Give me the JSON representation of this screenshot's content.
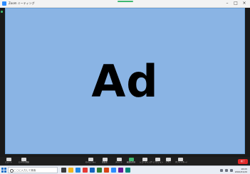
{
  "window": {
    "title": "Zoom ミーティング",
    "controls": [
      "–",
      "□",
      "×"
    ]
  },
  "slide": {
    "text": "Ad",
    "background": "#8ab4e4"
  },
  "meeting_bar": {
    "items": [
      {
        "label": "ミュート",
        "icon": "microphone-icon"
      },
      {
        "label": "ビデオの開始",
        "icon": "video-icon"
      },
      {
        "label": "セキュリティ",
        "icon": "shield-icon"
      },
      {
        "label": "参加者",
        "icon": "participants-icon"
      },
      {
        "label": "チャット",
        "icon": "chat-icon"
      },
      {
        "label": "画面を共有",
        "icon": "share-screen-icon"
      },
      {
        "label": "レコーディング",
        "icon": "record-icon"
      },
      {
        "label": "リアクション",
        "icon": "reaction-icon"
      },
      {
        "label": "アプリ",
        "icon": "apps-icon"
      },
      {
        "label": "ホワイトボード",
        "icon": "whiteboard-icon"
      }
    ],
    "end_label": "終了"
  },
  "taskbar": {
    "search_placeholder": "ここに入力して検索",
    "time": "18:05",
    "date": "2022/01/20"
  }
}
